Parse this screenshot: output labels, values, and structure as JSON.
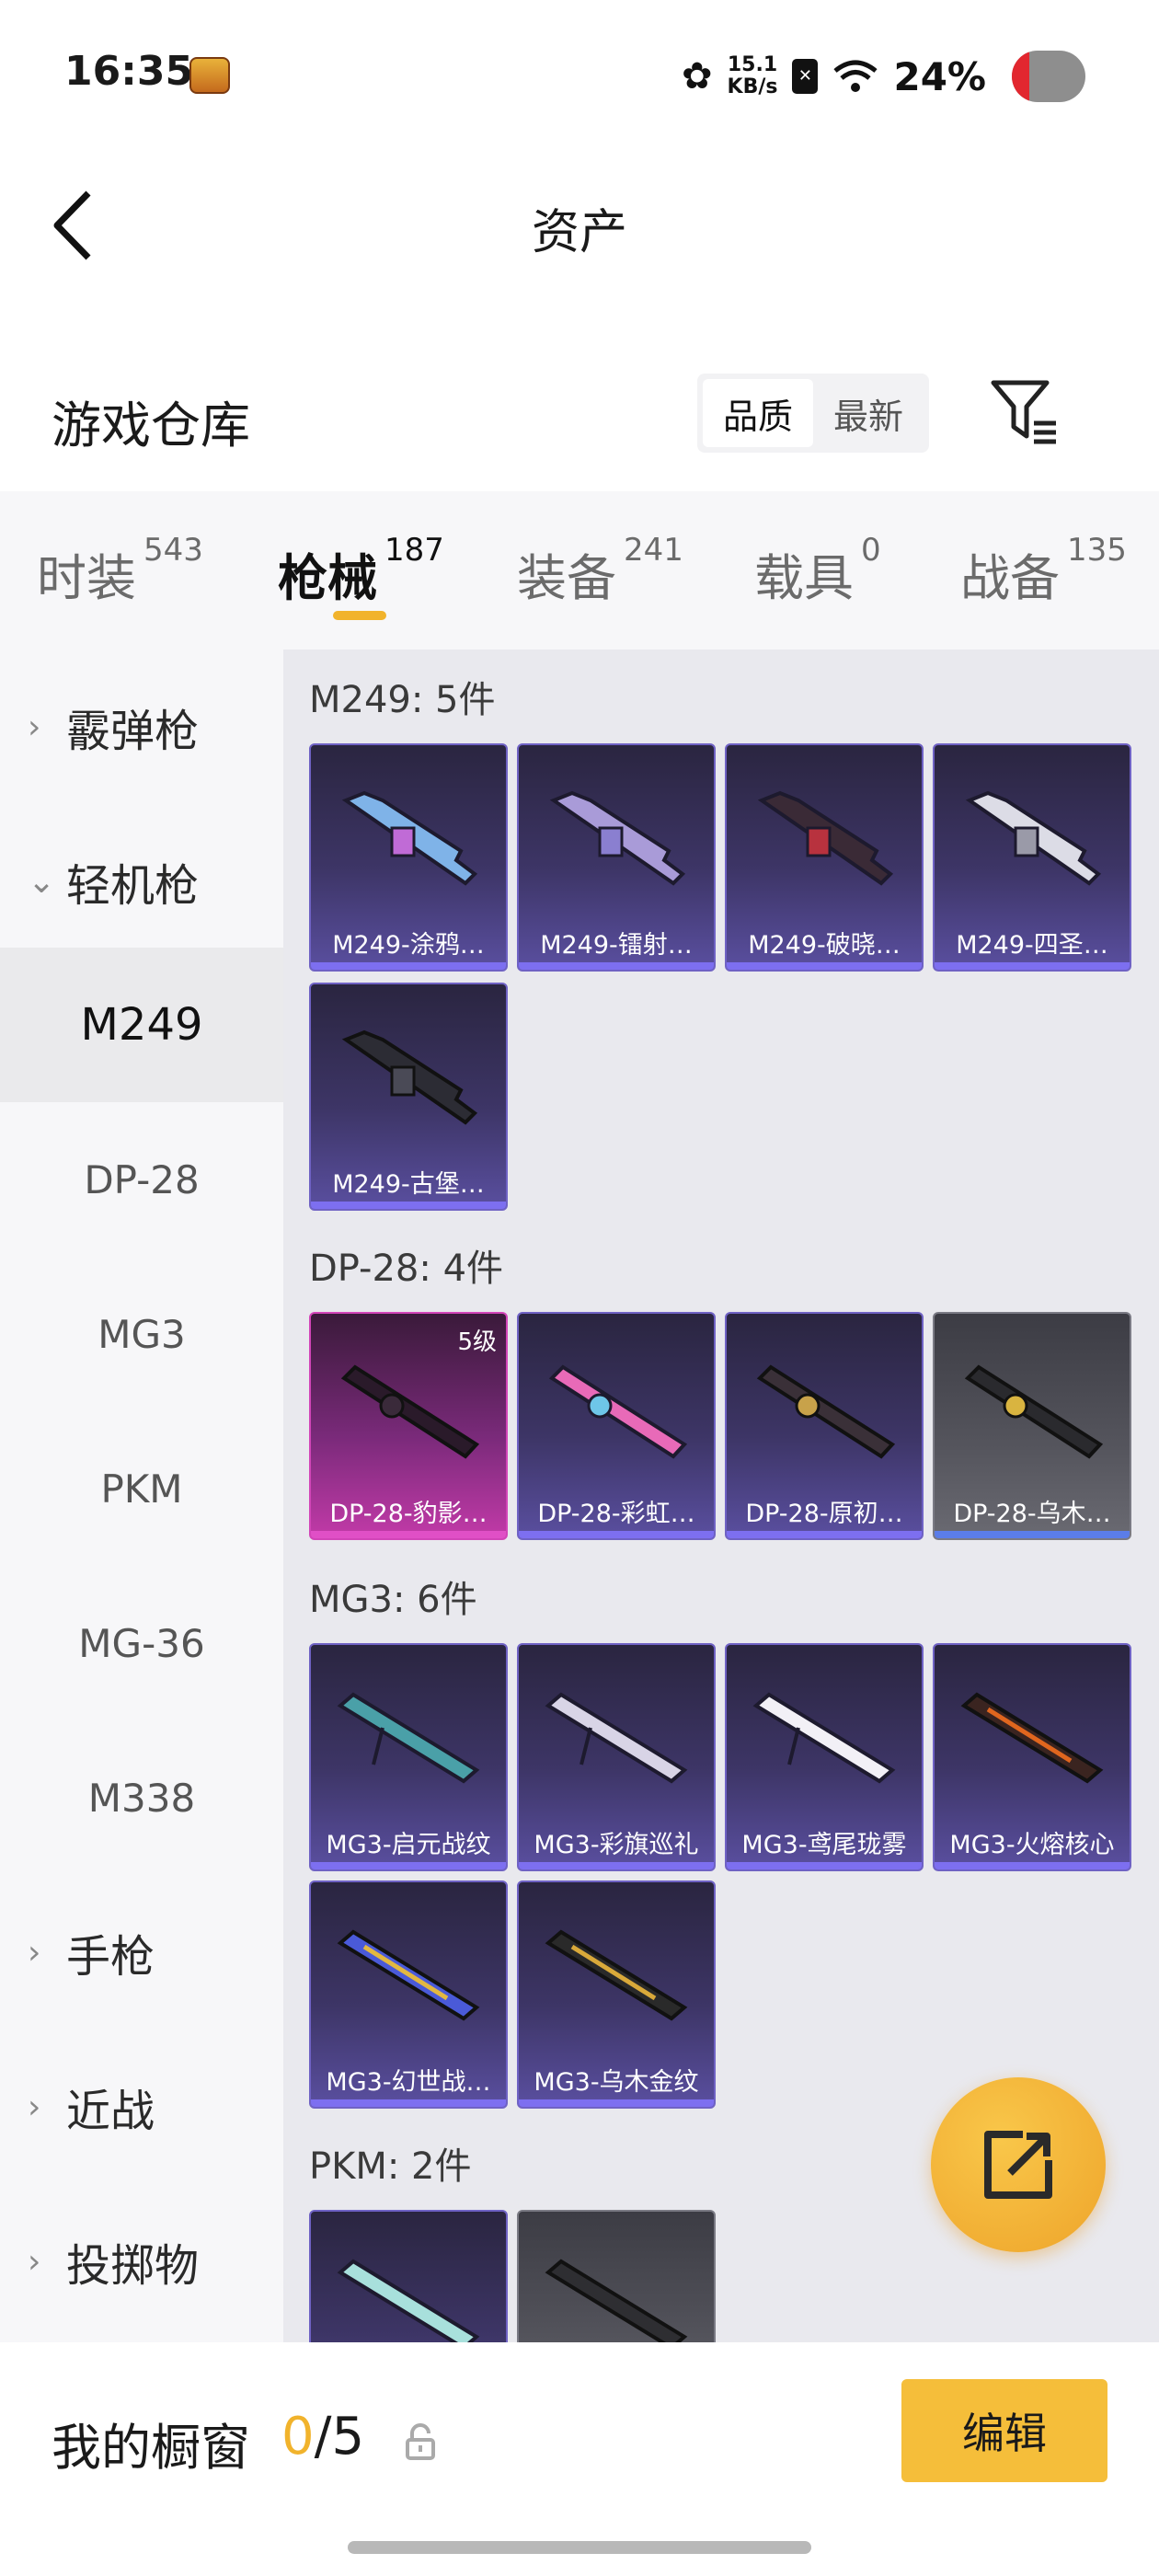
{
  "status_bar": {
    "time": "16:35",
    "net_speed_value": "15.1",
    "net_speed_unit": "KB/s",
    "battery": "24%",
    "sim_icon": "sim-x-icon",
    "wifi_icon": "wifi-icon",
    "battery_level": 0.24
  },
  "nav": {
    "title": "资产",
    "back_icon": "chevron-left-icon"
  },
  "warehouse": {
    "title": "游戏仓库",
    "sort_options": [
      "品质",
      "最新"
    ],
    "active_sort": "品质",
    "filter_icon": "filter-icon"
  },
  "categories": [
    {
      "label": "时装",
      "count": "543"
    },
    {
      "label": "枪械",
      "count": "187",
      "active": true
    },
    {
      "label": "装备",
      "count": "241"
    },
    {
      "label": "载具",
      "count": "0"
    },
    {
      "label": "战备",
      "count": "135"
    }
  ],
  "sidebar": {
    "shotgun": "霰弹枪",
    "lmg": "轻机枪",
    "m249": "M249",
    "dp28": "DP-28",
    "mg3": "MG3",
    "pkm": "PKM",
    "mg36": "MG-36",
    "m338": "M338",
    "pistol": "手枪",
    "melee": "近战",
    "throwable": "投掷物"
  },
  "groups": {
    "m249": {
      "title": "M249: 5件",
      "items": [
        "M249-涂鸦…",
        "M249-镭射…",
        "M249-破晓…",
        "M249-四圣…",
        "M249-古堡…"
      ]
    },
    "dp28": {
      "title": "DP-28: 4件",
      "items": [
        "DP-28-豹影…",
        "DP-28-彩虹…",
        "DP-28-原初…",
        "DP-28-乌木…"
      ],
      "level_badge": "5级"
    },
    "mg3": {
      "title": "MG3: 6件",
      "items": [
        "MG3-启元战纹",
        "MG3-彩旗巡礼",
        "MG3-鸢尾珑雾",
        "MG3-火熔核心",
        "MG3-幻世战…",
        "MG3-乌木金纹"
      ]
    },
    "pkm": {
      "title": "PKM: 2件"
    }
  },
  "colors": {
    "accent": "#f1b32c",
    "epic": "#6f62c4",
    "legendary": "#d245b8",
    "common": "#7a7a84"
  },
  "share_icon": "share-external-icon",
  "bottom": {
    "showcase_label": "我的橱窗",
    "showcase_current": "0",
    "showcase_total": "/5",
    "lock_icon": "lock-icon",
    "edit_label": "编辑"
  }
}
